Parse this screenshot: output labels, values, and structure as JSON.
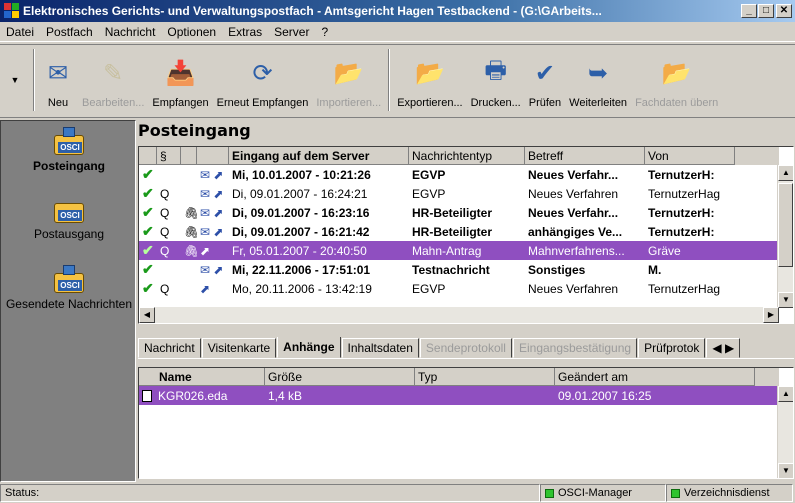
{
  "window": {
    "title": "Elektronisches Gerichts- und Verwaltungspostfach - Amtsgericht Hagen Testbackend - (G:\\GArbeits..."
  },
  "menu": [
    "Datei",
    "Postfach",
    "Nachricht",
    "Optionen",
    "Extras",
    "Server",
    "?"
  ],
  "toolbar": [
    {
      "label": "Neu",
      "icon": "new-message-icon",
      "enabled": true
    },
    {
      "label": "Bearbeiten...",
      "icon": "edit-icon",
      "enabled": false
    },
    {
      "label": "Empfangen",
      "icon": "receive-icon",
      "enabled": true
    },
    {
      "label": "Erneut Empfangen",
      "icon": "receive-again-icon",
      "enabled": true
    },
    {
      "label": "Importieren...",
      "icon": "import-folder-icon",
      "enabled": false
    },
    {
      "label": "Exportieren...",
      "icon": "export-folder-icon",
      "enabled": true
    },
    {
      "label": "Drucken...",
      "icon": "printer-icon",
      "enabled": true
    },
    {
      "label": "Prüfen",
      "icon": "verify-icon",
      "enabled": true
    },
    {
      "label": "Weiterleiten",
      "icon": "forward-icon",
      "enabled": true
    },
    {
      "label": "Fachdaten übern",
      "icon": "adopt-data-icon",
      "enabled": false
    }
  ],
  "sidebar": [
    {
      "label": "Posteingang",
      "active": true,
      "icon": "inbox-osci-icon"
    },
    {
      "label": "Postausgang",
      "active": false,
      "icon": "outbox-osci-icon"
    },
    {
      "label": "Gesendete Nachrichten",
      "active": false,
      "icon": "sent-osci-icon"
    }
  ],
  "inbox": {
    "title": "Posteingang",
    "columns": [
      "",
      "§",
      "",
      "",
      "Eingang auf dem Server",
      "Nachrichtentyp",
      "Betreff",
      "Von"
    ],
    "rows": [
      {
        "sig": "",
        "att": false,
        "env": "✉",
        "fwd": "⬈",
        "date": "Mi, 10.01.2007 - 10:21:26",
        "type": "EGVP",
        "subject": "Neues Verfahr...",
        "from": "TernutzerH:",
        "bold": true,
        "selected": false
      },
      {
        "sig": "Q",
        "att": false,
        "env": "✉",
        "fwd": "⬈",
        "date": "Di, 09.01.2007 - 16:24:21",
        "type": "EGVP",
        "subject": "Neues Verfahren",
        "from": "TernutzerHag",
        "bold": false,
        "selected": false
      },
      {
        "sig": "Q",
        "att": true,
        "env": "✉",
        "fwd": "⬈",
        "date": "Di, 09.01.2007 - 16:23:16",
        "type": "HR-Beteiligter",
        "subject": "Neues Verfahr...",
        "from": "TernutzerH:",
        "bold": true,
        "selected": false
      },
      {
        "sig": "Q",
        "att": true,
        "env": "✉",
        "fwd": "⬈",
        "date": "Di, 09.01.2007 - 16:21:42",
        "type": "HR-Beteiligter",
        "subject": "anhängiges Ve...",
        "from": "TernutzerH:",
        "bold": true,
        "selected": false
      },
      {
        "sig": "Q",
        "att": true,
        "env": "",
        "fwd": "⬈",
        "date": "Fr, 05.01.2007 - 20:40:50",
        "type": "Mahn-Antrag",
        "subject": "Mahnverfahrens...",
        "from": "Gräve",
        "bold": false,
        "selected": true
      },
      {
        "sig": "",
        "att": false,
        "env": "✉",
        "fwd": "⬈",
        "date": "Mi, 22.11.2006 - 17:51:01",
        "type": "Testnachricht",
        "subject": "Sonstiges",
        "from": "M.",
        "bold": true,
        "selected": false
      },
      {
        "sig": "Q",
        "att": false,
        "env": "",
        "fwd": "⬈",
        "date": "Mo, 20.11.2006 - 13:42:19",
        "type": "EGVP",
        "subject": "Neues Verfahren",
        "from": "TernutzerHag",
        "bold": false,
        "selected": false
      }
    ]
  },
  "tabs": [
    {
      "label": "Nachricht",
      "active": false,
      "enabled": true
    },
    {
      "label": "Visitenkarte",
      "active": false,
      "enabled": true
    },
    {
      "label": "Anhänge",
      "active": true,
      "enabled": true
    },
    {
      "label": "Inhaltsdaten",
      "active": false,
      "enabled": true
    },
    {
      "label": "Sendeprotokoll",
      "active": false,
      "enabled": false
    },
    {
      "label": "Eingangsbestätigung",
      "active": false,
      "enabled": false
    },
    {
      "label": "Prüfprotok",
      "active": false,
      "enabled": true
    }
  ],
  "attachments": {
    "columns": [
      "Name",
      "Größe",
      "Typ",
      "Geändert am"
    ],
    "rows": [
      {
        "name": "KGR026.eda",
        "size": "1,4 kB",
        "type": "",
        "modified": "09.01.2007 16:25",
        "selected": true
      }
    ]
  },
  "status": {
    "label": "Status:",
    "indicators": [
      {
        "label": "OSCI-Manager",
        "color": "#2fc42f"
      },
      {
        "label": "Verzeichnisdienst",
        "color": "#2fc42f"
      }
    ]
  },
  "colors": {
    "selection": "#8f4fc0",
    "face": "#d4d0c8",
    "check": "#1a9a1a"
  }
}
